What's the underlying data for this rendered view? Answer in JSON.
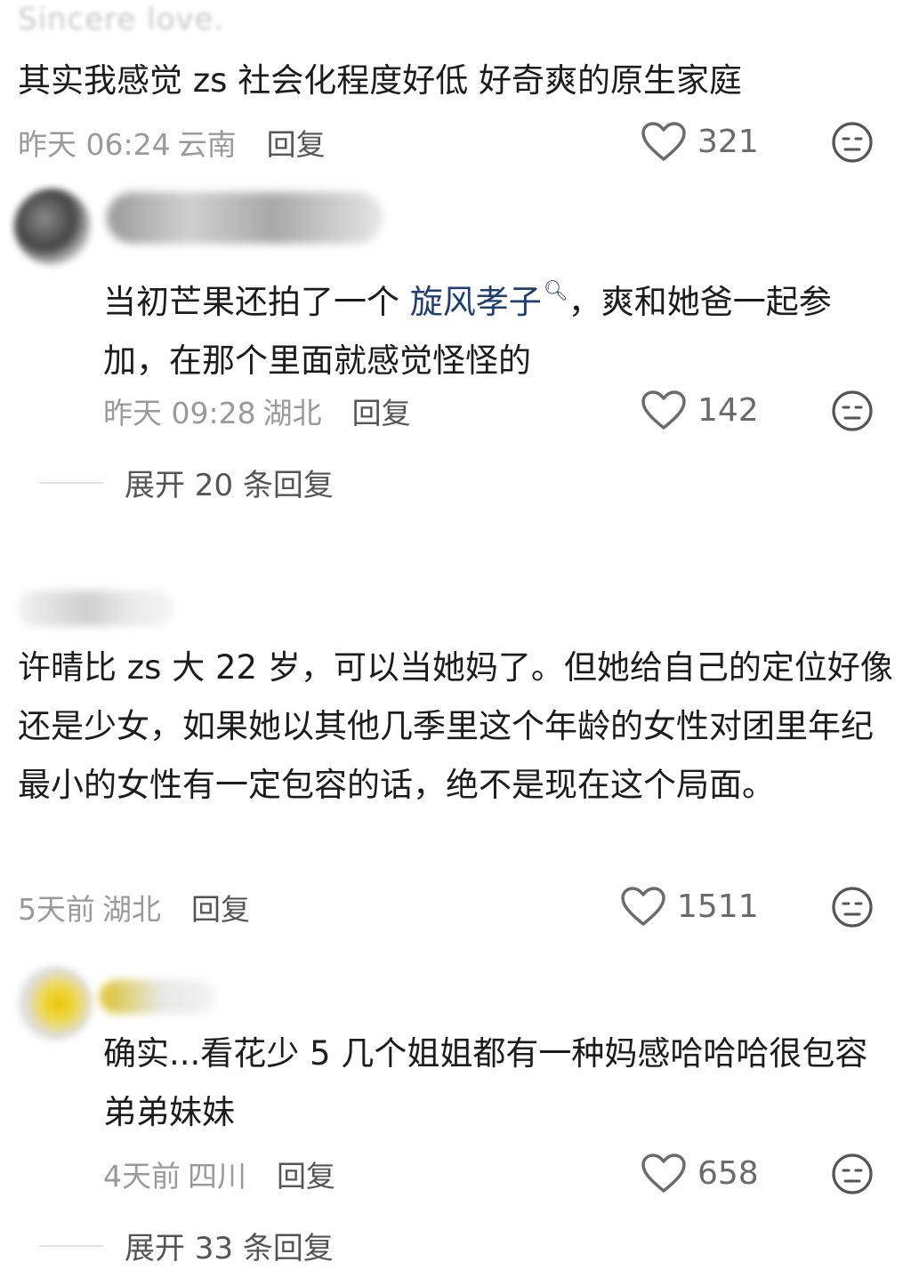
{
  "comments": [
    {
      "username": "Sincere love.",
      "text": "其实我感觉 zs 社会化程度好低 好奇爽的原生家庭",
      "time": "昨天 06:24",
      "location": "云南",
      "reply_label": "回复",
      "likes": "321"
    },
    {
      "text_before_link": "当初芒果还拍了一个 ",
      "link_text": "旋风孝子",
      "link_icon": "search-icon",
      "text_after_link": "，爽和她爸一起参加，在那个里面就感觉怪怪的",
      "time": "昨天 09:28",
      "location": "湖北",
      "reply_label": "回复",
      "likes": "142",
      "expand_label": "展开 20 条回复"
    },
    {
      "text": "许晴比 zs 大 22 岁，可以当她妈了。但她给自己的定位好像还是少女，如果她以其他几季里这个年龄的女性对团里年纪最小的女性有一定包容的话，绝不是现在这个局面。",
      "time": "5天前",
      "location": "湖北",
      "reply_label": "回复",
      "likes": "1511"
    },
    {
      "text": "确实...看花少 5 几个姐姐都有一种妈感哈哈哈很包容弟弟妹妹",
      "time": "4天前",
      "location": "四川",
      "reply_label": "回复",
      "likes": "658",
      "expand_label": "展开 33 条回复"
    }
  ],
  "icons": {
    "like": "heart-outline-icon",
    "reaction": "neutral-face-icon"
  }
}
